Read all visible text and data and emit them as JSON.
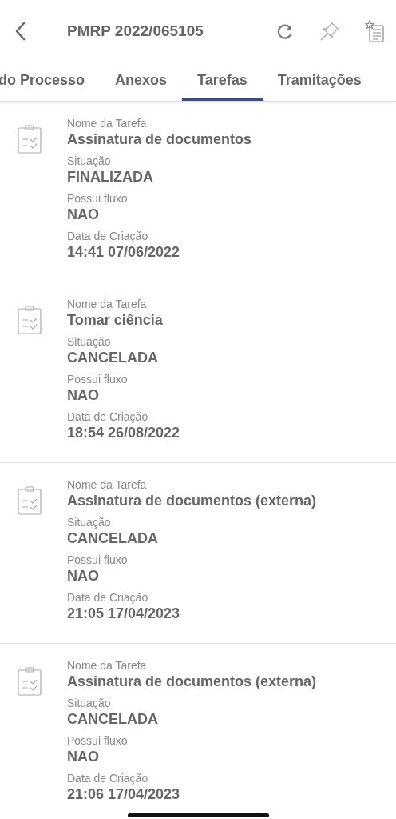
{
  "header": {
    "title": "PMRP 2022/065105"
  },
  "tabs": [
    {
      "label": "do Processo",
      "selected": false
    },
    {
      "label": "Anexos",
      "selected": false
    },
    {
      "label": "Tarefas",
      "selected": true
    },
    {
      "label": "Tramitações",
      "selected": false
    }
  ],
  "tasks": [
    {
      "fields": [
        {
          "label": "Nome da Tarefa",
          "value": "Assinatura de documentos"
        },
        {
          "label": "Situação",
          "value": "FINALIZADA"
        },
        {
          "label": "Possui fluxo",
          "value": "NAO"
        },
        {
          "label": "Data de Criação",
          "value": "14:41 07/06/2022"
        }
      ]
    },
    {
      "fields": [
        {
          "label": "Nome da Tarefa",
          "value": "Tomar ciência"
        },
        {
          "label": "Situação",
          "value": "CANCELADA"
        },
        {
          "label": "Possui fluxo",
          "value": "NAO"
        },
        {
          "label": "Data de Criação",
          "value": "18:54 26/08/2022"
        }
      ]
    },
    {
      "fields": [
        {
          "label": "Nome da Tarefa",
          "value": "Assinatura de documentos (externa)"
        },
        {
          "label": "Situação",
          "value": "CANCELADA"
        },
        {
          "label": "Possui fluxo",
          "value": "NAO"
        },
        {
          "label": "Data de Criação",
          "value": "21:05 17/04/2023"
        }
      ]
    },
    {
      "fields": [
        {
          "label": "Nome da Tarefa",
          "value": "Assinatura de documentos (externa)"
        },
        {
          "label": "Situação",
          "value": "CANCELADA"
        },
        {
          "label": "Possui fluxo",
          "value": "NAO"
        },
        {
          "label": "Data de Criação",
          "value": "21:06 17/04/2023"
        }
      ]
    }
  ]
}
